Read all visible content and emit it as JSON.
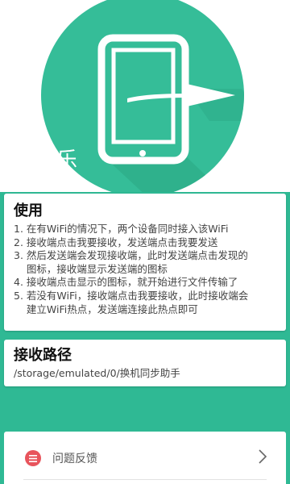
{
  "colors": {
    "brand_green": "#2fb994",
    "hero_circle": "#35bd98",
    "feedback_icon": "#e8545c"
  },
  "hero": {
    "icon": "tablet-send-arrow-icon",
    "partial_text": "乐"
  },
  "usage": {
    "title": "使用",
    "lines": [
      "1. 在有WiFi的情况下，两个设备同时接入该WiFi",
      "2. 接收端点击我要接收，发送端点击我要发送",
      "3. 然后发送端会发现接收端，此时发送端点击发现的",
      "    图标，接收端显示发送端的图标",
      "4. 接收端点击显示的图标，就开始进行文件传输了",
      "5. 若没有WiFi，接收端点击我要接收，此时接收端会",
      "    建立WiFi热点，发送端连接此热点即可"
    ]
  },
  "receive_path": {
    "title": "接收路径",
    "path": "/storage/emulated/0/换机同步助手"
  },
  "feedback": {
    "label": "问题反馈",
    "icon": "menu-lines-icon",
    "chevron": "chevron-right-icon"
  }
}
